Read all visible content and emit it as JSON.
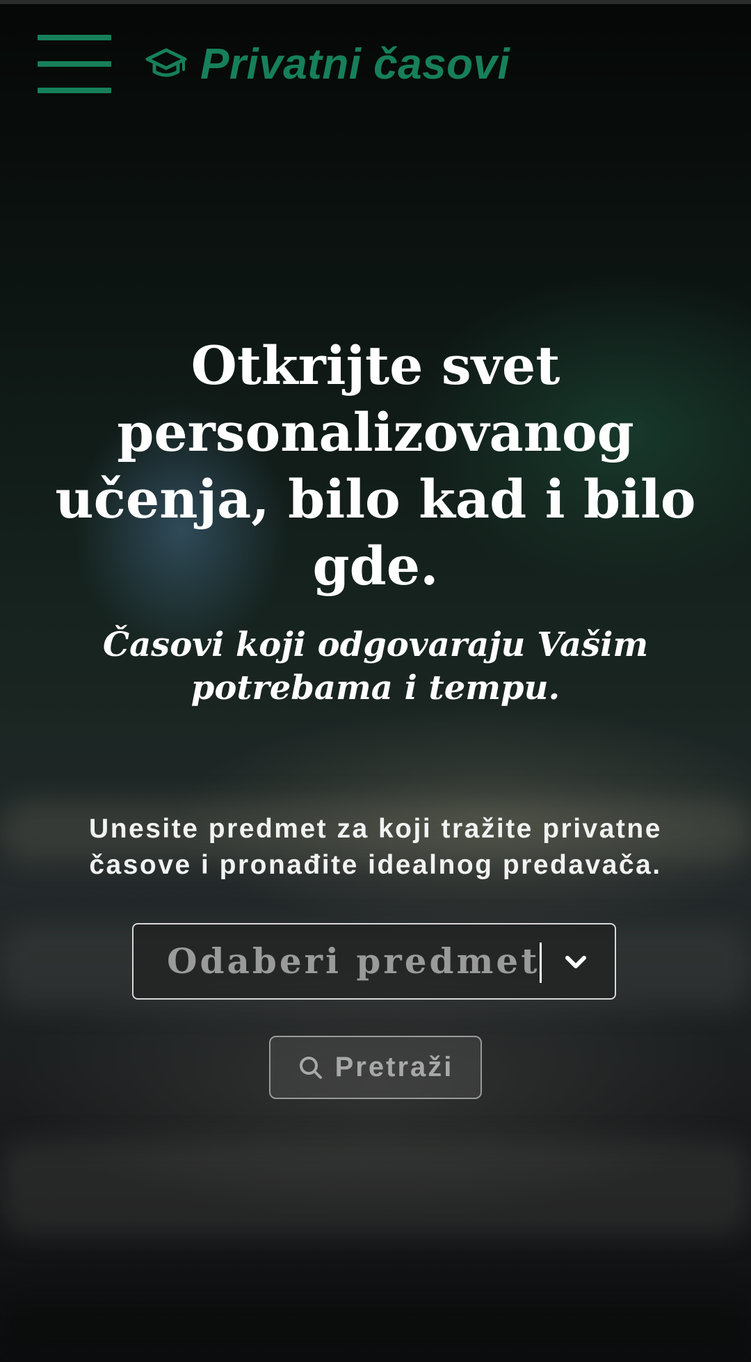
{
  "header": {
    "menu_icon": "hamburger-menu-icon",
    "brand_icon": "graduation-cap-icon",
    "brand_name": "Privatni časovi"
  },
  "hero": {
    "title": "Otkrijte svet personalizovanog učenja, bilo kad i bilo gde.",
    "subtitle": "Časovi koji odgovaraju Vašim potrebama i tempu.",
    "search_hint": "Unesite predmet za koji tražite privatne časove i pronađite idealnog predavača.",
    "subject_select": {
      "placeholder": "Odaberi predmet",
      "icon": "chevron-down-icon"
    },
    "search_button": {
      "label": "Pretraži",
      "icon": "search-icon"
    }
  },
  "colors": {
    "brand_green": "#16805a",
    "text_white": "#ffffff",
    "placeholder_gray": "#9a9a9a"
  }
}
